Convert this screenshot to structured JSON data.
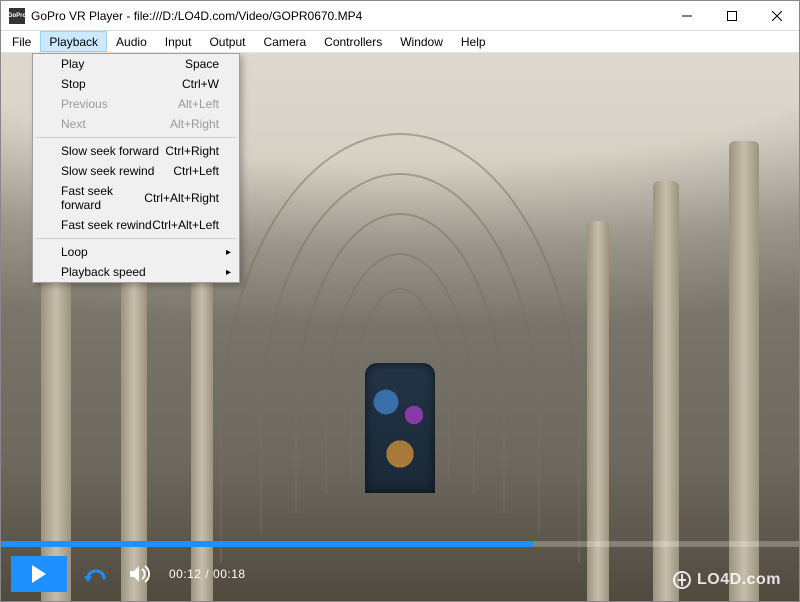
{
  "titlebar": {
    "title": "GoPro VR Player - file:///D:/LO4D.com/Video/GOPR0670.MP4",
    "appIconText": "GoPro"
  },
  "menubar": {
    "items": [
      "File",
      "Playback",
      "Audio",
      "Input",
      "Output",
      "Camera",
      "Controllers",
      "Window",
      "Help"
    ],
    "openIndex": 1
  },
  "dropdown": {
    "groups": [
      [
        {
          "label": "Play",
          "shortcut": "Space",
          "disabled": false
        },
        {
          "label": "Stop",
          "shortcut": "Ctrl+W",
          "disabled": false
        },
        {
          "label": "Previous",
          "shortcut": "Alt+Left",
          "disabled": true
        },
        {
          "label": "Next",
          "shortcut": "Alt+Right",
          "disabled": true
        }
      ],
      [
        {
          "label": "Slow seek forward",
          "shortcut": "Ctrl+Right",
          "disabled": false
        },
        {
          "label": "Slow seek rewind",
          "shortcut": "Ctrl+Left",
          "disabled": false
        },
        {
          "label": "Fast seek forward",
          "shortcut": "Ctrl+Alt+Right",
          "disabled": false
        },
        {
          "label": "Fast seek rewind",
          "shortcut": "Ctrl+Alt+Left",
          "disabled": false
        }
      ],
      [
        {
          "label": "Loop",
          "submenu": true,
          "disabled": false
        },
        {
          "label": "Playback speed",
          "submenu": true,
          "disabled": false
        }
      ]
    ]
  },
  "player": {
    "currentTime": "00:12",
    "duration": "00:18",
    "progressPercent": 66.7
  },
  "icons": {
    "play": "play-icon",
    "loop": "loop-icon",
    "volume": "volume-icon",
    "minimize": "minimize-icon",
    "maximize": "maximize-icon",
    "close": "close-icon",
    "chevronRight": "chevron-right-icon"
  },
  "watermark": {
    "text": "LO4D.com"
  }
}
